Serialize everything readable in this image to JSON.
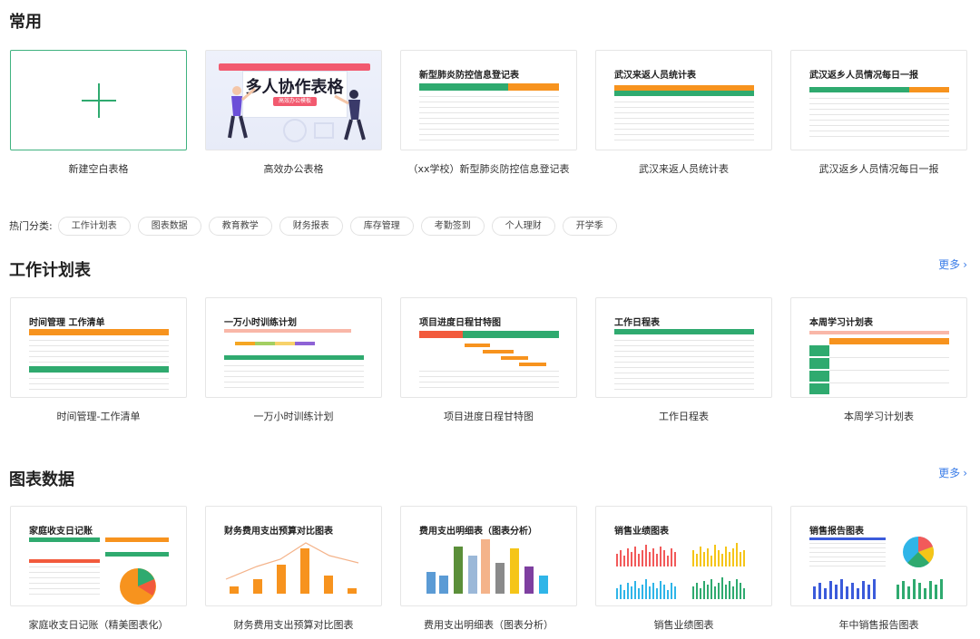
{
  "sections": {
    "common": {
      "title": "常用"
    },
    "work_plan": {
      "title": "工作计划表",
      "more": "更多"
    },
    "charts": {
      "title": "图表数据",
      "more": "更多"
    }
  },
  "hot": {
    "label": "热门分类:",
    "chips": [
      "工作计划表",
      "图表数据",
      "教育教学",
      "财务报表",
      "库存管理",
      "考勤签到",
      "个人理财",
      "开学季"
    ]
  },
  "common_cards": [
    {
      "label": "新建空白表格"
    },
    {
      "label": "高效办公表格",
      "banner_title": "多人协作表格",
      "banner_pill": "高效办公模板"
    },
    {
      "label": "（xx学校）新型肺炎防控信息登记表",
      "thumb_title": "新型肺炎防控信息登记表"
    },
    {
      "label": "武汉来返人员统计表",
      "thumb_title": "武汉来返人员统计表"
    },
    {
      "label": "武汉返乡人员情况每日一报",
      "thumb_title": "武汉返乡人员情况每日一报"
    }
  ],
  "work_cards": [
    {
      "label": "时间管理-工作清单",
      "thumb_title": "时间管理 工作清单"
    },
    {
      "label": "一万小时训练计划",
      "thumb_title": "一万小时训练计划"
    },
    {
      "label": "项目进度日程甘特图",
      "thumb_title": "项目进度日程甘特图"
    },
    {
      "label": "工作日程表",
      "thumb_title": "工作日程表"
    },
    {
      "label": "本周学习计划表",
      "thumb_title": "本周学习计划表"
    }
  ],
  "chart_cards": [
    {
      "label": "家庭收支日记账（精美图表化）",
      "thumb_title": "家庭收支日记账"
    },
    {
      "label": "财务费用支出预算对比图表",
      "thumb_title": "财务费用支出预算对比图表"
    },
    {
      "label": "费用支出明细表（图表分析）",
      "thumb_title": "费用支出明细表（图表分析）"
    },
    {
      "label": "销售业绩图表",
      "thumb_title": "销售业绩图表"
    },
    {
      "label": "年中销售报告图表",
      "thumb_title": "销售报告图表"
    }
  ],
  "colors": {
    "accent_green": "#2faa6f",
    "link_blue": "#3b7de8",
    "orange": "#f7931e",
    "banner_red": "#f25a6f"
  }
}
